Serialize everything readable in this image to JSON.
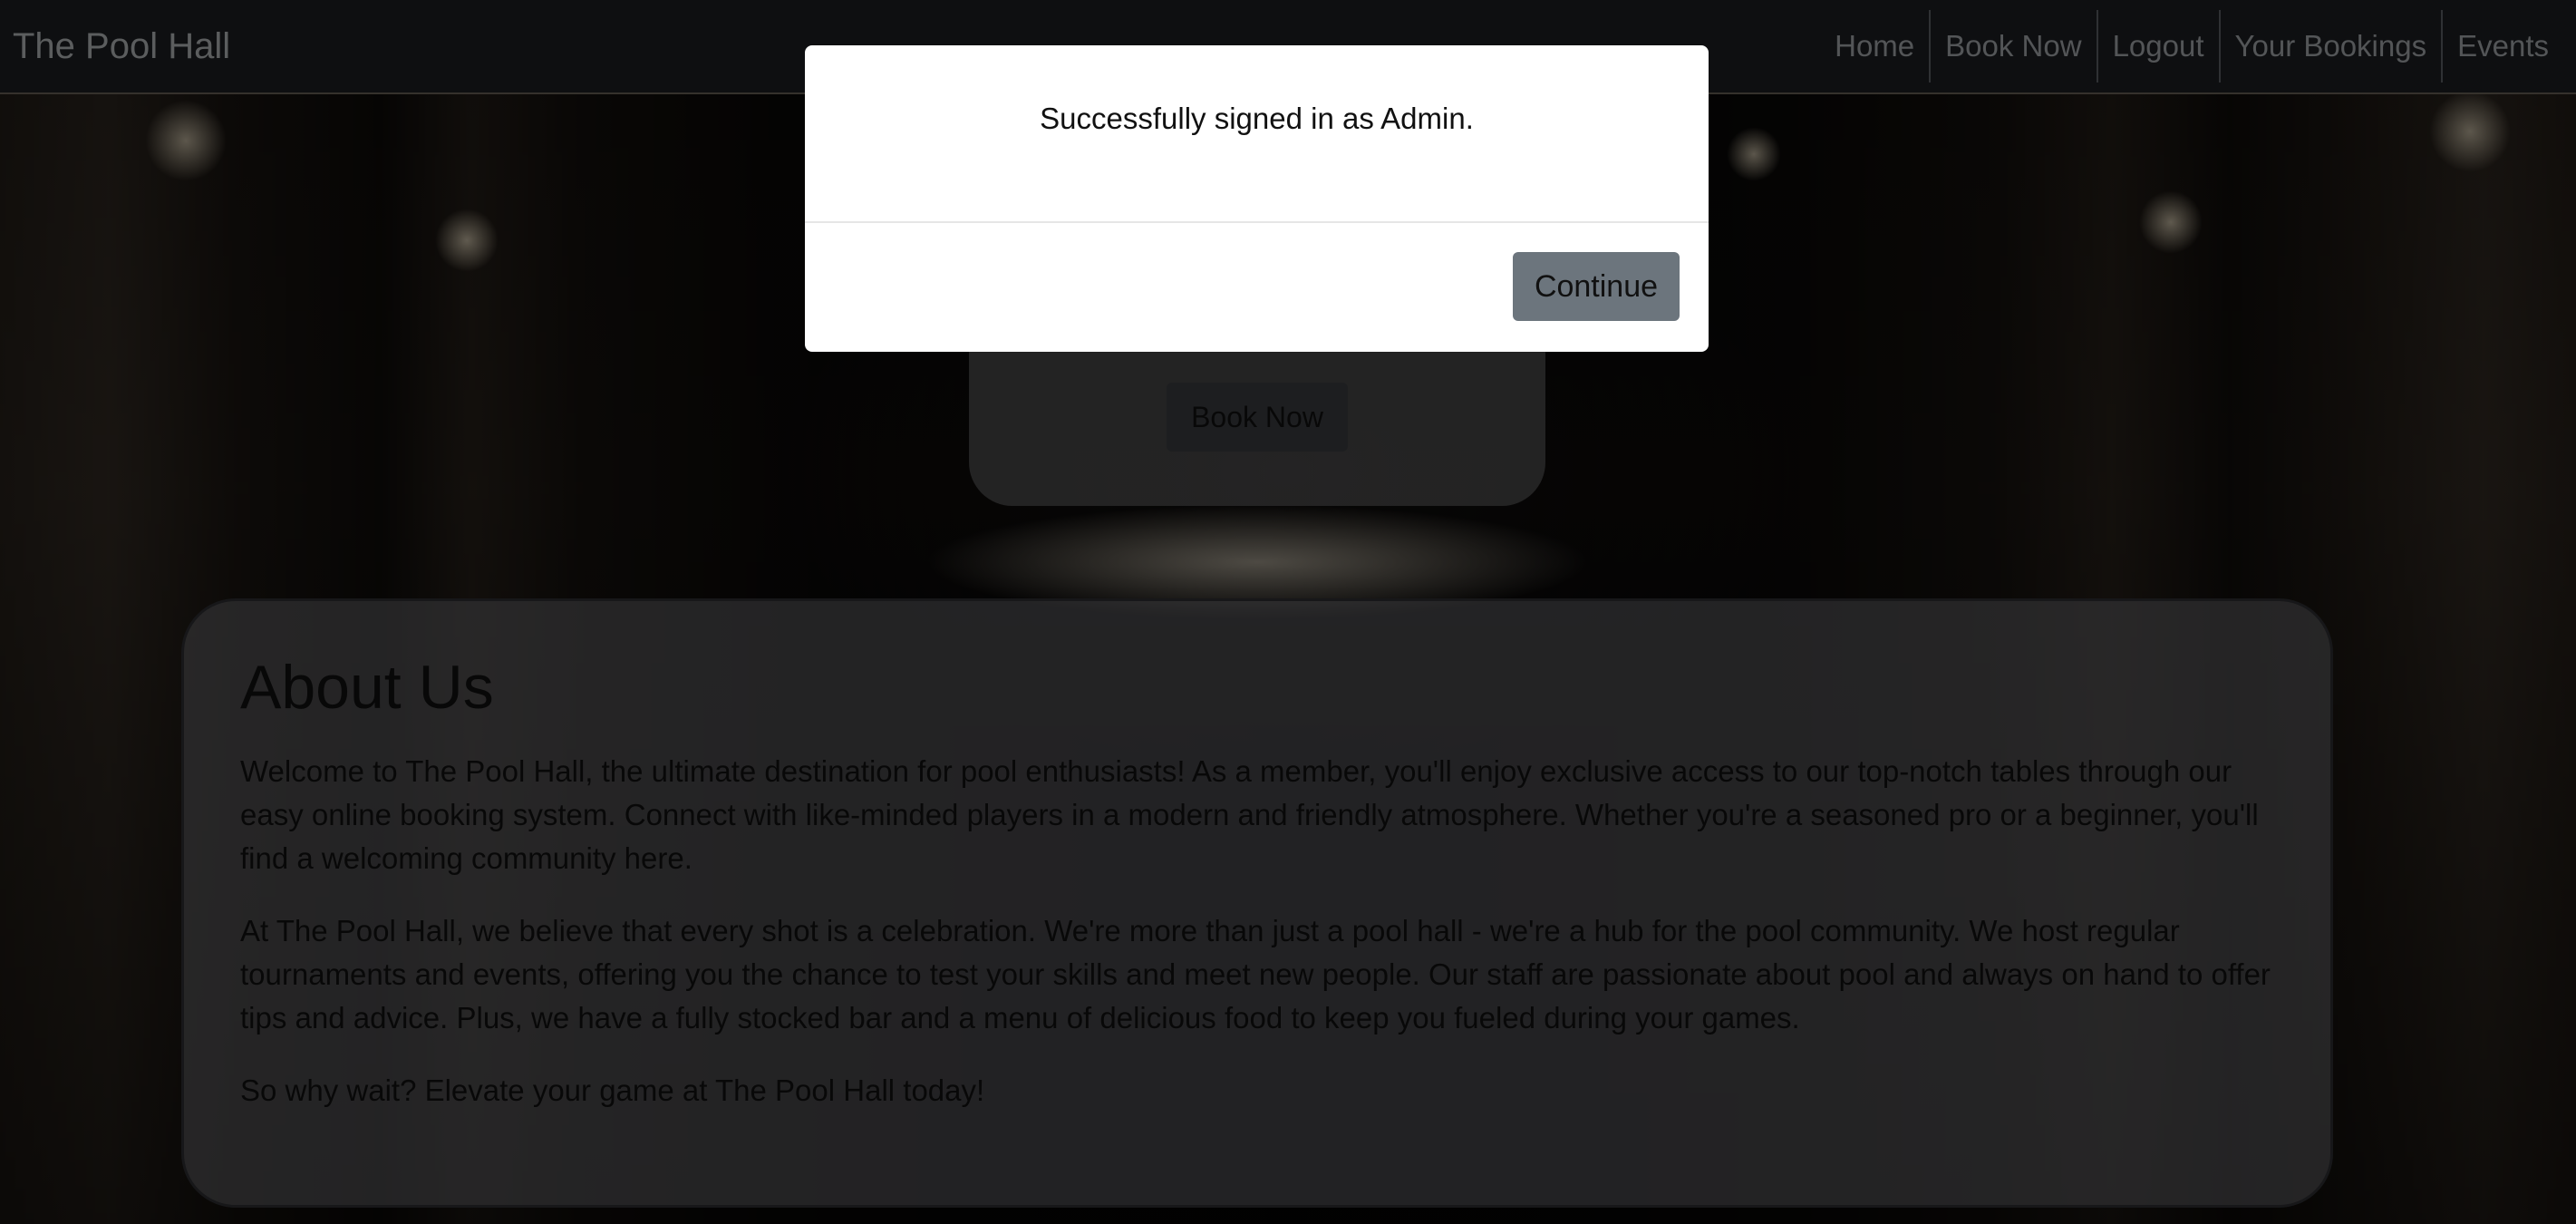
{
  "navbar": {
    "brand": "The Pool Hall",
    "links": [
      "Home",
      "Book Now",
      "Logout",
      "Your Bookings",
      "Events"
    ]
  },
  "hero": {
    "book_now_label": "Book Now"
  },
  "about": {
    "title": "About Us",
    "paragraphs": [
      "Welcome to The Pool Hall, the ultimate destination for pool enthusiasts! As a member, you'll enjoy exclusive access to our top-notch tables through our easy online booking system. Connect with like-minded players in a modern and friendly atmosphere. Whether you're a seasoned pro or a beginner, you'll find a welcoming community here.",
      "At The Pool Hall, we believe that every shot is a celebration. We're more than just a pool hall - we're a hub for the pool community. We host regular tournaments and events, offering you the chance to test your skills and meet new people. Our staff are passionate about pool and always on hand to offer tips and advice. Plus, we have a fully stocked bar and a menu of delicious food to keep you fueled during your games.",
      "So why wait? Elevate your game at The Pool Hall today!"
    ]
  },
  "modal": {
    "message": "Successfully signed in as Admin.",
    "continue_label": "Continue"
  },
  "colors": {
    "navbar_bg": "#1c1f23",
    "button_secondary": "#6c757d",
    "modal_bg": "#ffffff"
  }
}
